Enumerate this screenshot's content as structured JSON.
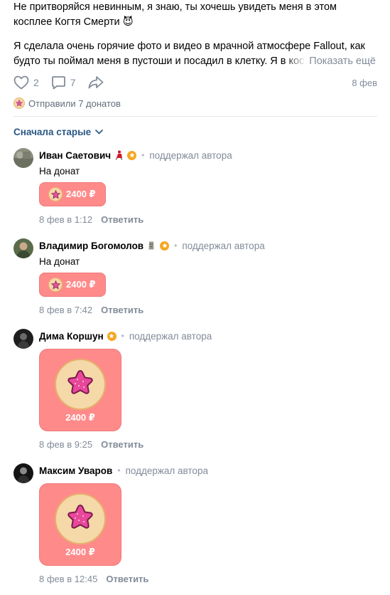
{
  "post": {
    "text1": "Не притворяйся невинным, я знаю, ты хочешь увидеть меня в этом косплее Когтя Смерти 😈",
    "text2": "Я сделала очень горячие фото и видео в мрачной атмосфере Fallout, как будто ты поймал меня в пустоши и посадил в клетку. Я в костюме",
    "show_more": "Показать ещё",
    "likes": "2",
    "comments": "7",
    "date": "8 фев",
    "donations": "Отправили 7 донатов"
  },
  "sort_label": "Сначала старые",
  "comments": [
    {
      "name": "Иван Саетович",
      "meta": "поддержал автора",
      "text": "На донат",
      "amount": "2400 ₽",
      "date": "8 фев в 1:12",
      "reply": "Ответить"
    },
    {
      "name": "Владимир Богомолов",
      "meta": "поддержал автора",
      "text": "На донат",
      "amount": "2400 ₽",
      "date": "8 фев в 7:42",
      "reply": "Ответить"
    },
    {
      "name": "Дима Коршун",
      "meta": "поддержал автора",
      "amount": "2400 ₽",
      "date": "8 фев в 9:25",
      "reply": "Ответить"
    },
    {
      "name": "Максим Уваров",
      "meta": "поддержал автора",
      "amount": "2400 ₽",
      "date": "8 фев в 12:45",
      "reply": "Ответить"
    }
  ],
  "colors": {
    "accent": "#2a5885",
    "donation_bg": "#ff8a8a",
    "coin": "#f5d7a8",
    "star": "#e0569b"
  },
  "icons": [
    "heart-icon",
    "comment-icon",
    "share-icon",
    "chevron-down-icon",
    "star-coin-icon",
    "premium-badge-icon"
  ]
}
